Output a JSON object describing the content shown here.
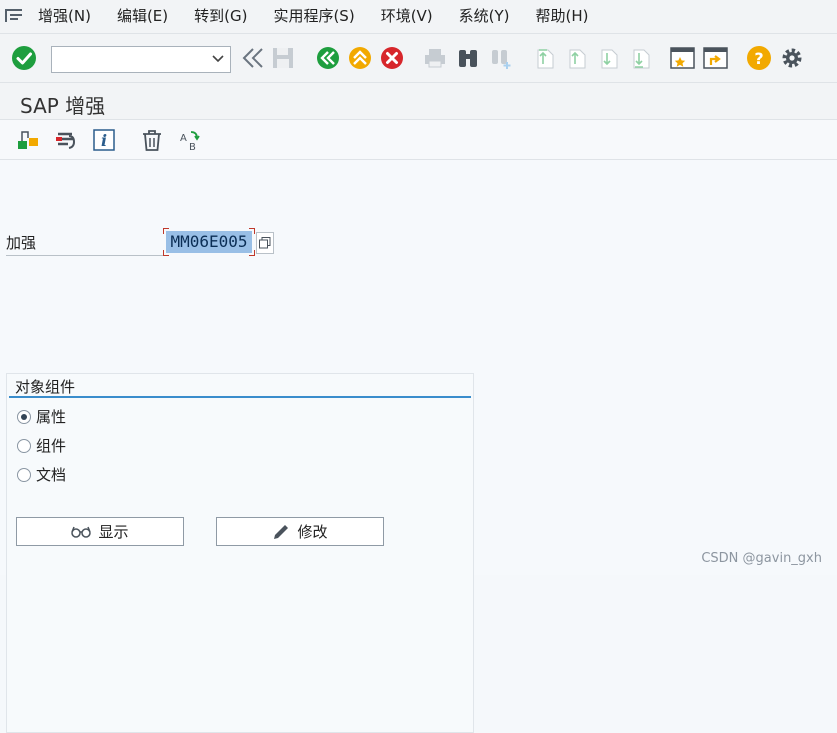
{
  "menubar": {
    "items": [
      "增强(N)",
      "编辑(E)",
      "转到(G)",
      "实用程序(S)",
      "环境(V)",
      "系统(Y)",
      "帮助(H)"
    ]
  },
  "toolbar": {
    "command_value": "",
    "icons": [
      "check-icon",
      "dropdown-icon",
      "double-left-icon",
      "save-icon",
      "back-icon",
      "exit-icon",
      "cancel-icon",
      "print-icon",
      "find-icon",
      "find-next-icon",
      "first-page-icon",
      "previous-page-icon",
      "next-page-icon",
      "last-page-icon",
      "new-session-icon",
      "shortcut-icon",
      "help-icon",
      "settings-icon"
    ]
  },
  "title": "SAP 增强",
  "app_toolbar": {
    "icons": [
      "components-icon",
      "transport-icon",
      "info-icon",
      "delete-icon",
      "rename-icon"
    ]
  },
  "field": {
    "label": "加强",
    "value": "MM06E005"
  },
  "group": {
    "title": "对象组件",
    "options": [
      {
        "label": "属性",
        "selected": true
      },
      {
        "label": "组件",
        "selected": false
      },
      {
        "label": "文档",
        "selected": false
      }
    ]
  },
  "buttons": {
    "display": "显示",
    "change": "修改"
  },
  "watermark": "CSDN @gavin_gxh",
  "colors": {
    "accent_blue": "#3a8dcc",
    "green": "#1e9e3e",
    "yellow": "#f2a900",
    "red": "#d7262b",
    "selection": "#99bfe6"
  }
}
